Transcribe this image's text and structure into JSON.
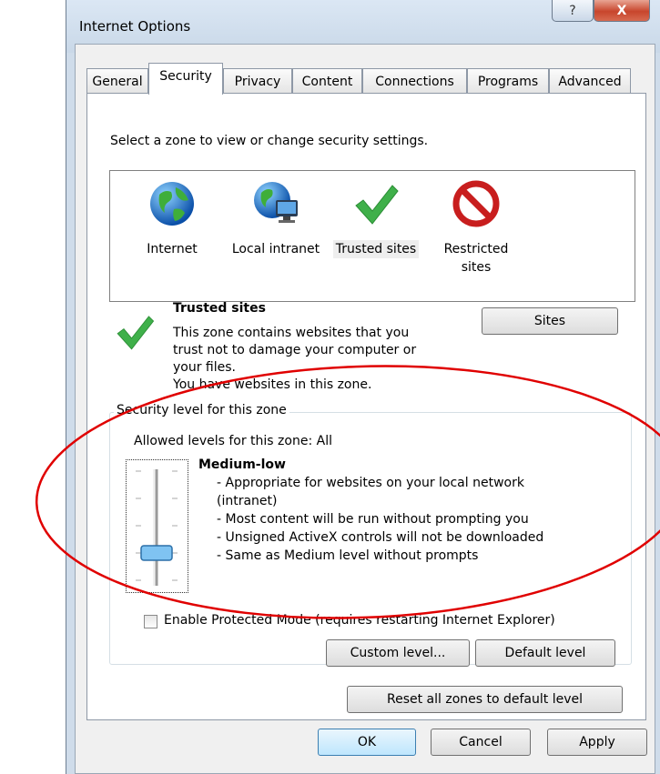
{
  "window": {
    "title": "Internet Options",
    "help_glyph": "?",
    "close_glyph": "X"
  },
  "tabs": [
    {
      "label": "General",
      "active": false
    },
    {
      "label": "Security",
      "active": true
    },
    {
      "label": "Privacy",
      "active": false
    },
    {
      "label": "Content",
      "active": false
    },
    {
      "label": "Connections",
      "active": false
    },
    {
      "label": "Programs",
      "active": false
    },
    {
      "label": "Advanced",
      "active": false
    }
  ],
  "security": {
    "select_prompt": "Select a zone to view or change security settings.",
    "zones": [
      {
        "label": "Internet",
        "icon": "globe-icon"
      },
      {
        "label": "Local intranet",
        "icon": "local-intranet-icon"
      },
      {
        "label": "Trusted sites",
        "icon": "green-check-icon",
        "selected": true
      },
      {
        "label": "Restricted sites",
        "line1": "Restricted",
        "line2": "sites",
        "icon": "no-entry-icon"
      }
    ],
    "zone_info": {
      "title": "Trusted sites",
      "desc_lines": [
        "This zone contains websites that you",
        "trust not to damage your computer or",
        "your files.",
        "You have websites in this zone."
      ],
      "sites_button": "Sites"
    },
    "level_group": {
      "label": "Security level for this zone",
      "allowed": "Allowed levels for this zone: All",
      "level_name": "Medium-low",
      "bullets": [
        "- Appropriate for websites on your local network",
        "(intranet)",
        "- Most content will be run without prompting you",
        "- Unsigned ActiveX controls will not be downloaded",
        "- Same as Medium level without prompts"
      ],
      "slider_level": "Medium-low",
      "protected_mode_label": "Enable Protected Mode (requires restarting Internet Explorer)",
      "protected_mode_checked": false,
      "custom_button": "Custom level...",
      "default_button": "Default level"
    },
    "reset_button": "Reset all zones to default level"
  },
  "footer": {
    "ok": "OK",
    "cancel": "Cancel",
    "apply": "Apply"
  },
  "colors": {
    "annotation_oval": "#e00000",
    "accent_button": "#3c7fb1"
  }
}
